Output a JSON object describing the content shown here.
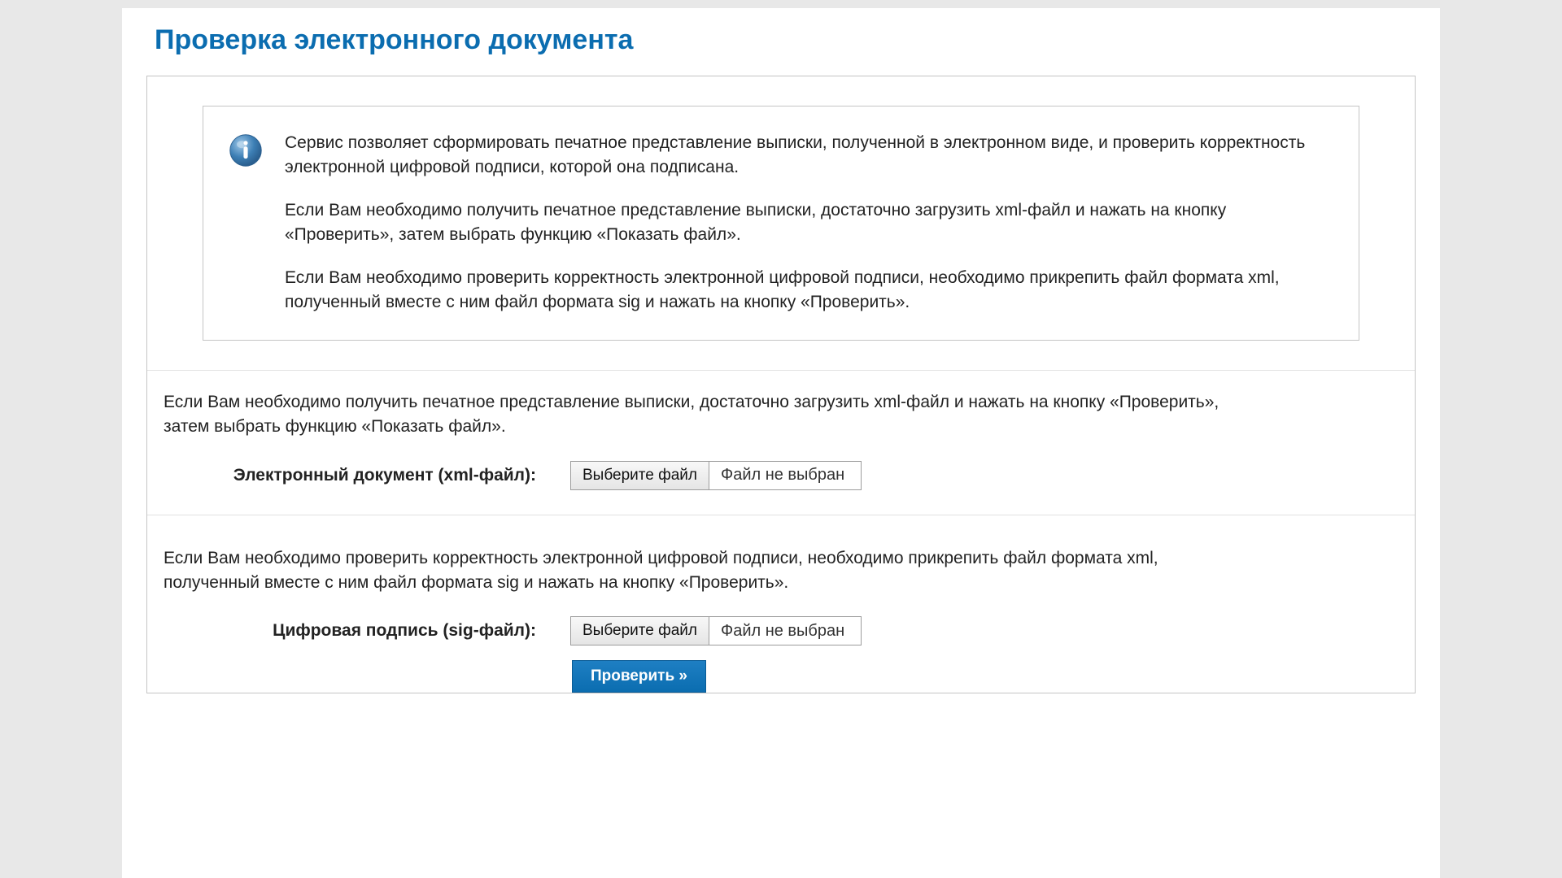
{
  "header": {
    "title": "Проверка электронного документа"
  },
  "info": {
    "p1": "Сервис позволяет сформировать печатное представление выписки, полученной в электронном виде, и проверить корректность электронной цифровой подписи, которой она подписана.",
    "p2": "Если Вам необходимо получить печатное представление выписки, достаточно загрузить xml-файл и нажать на кнопку «Проверить», затем выбрать функцию «Показать файл».",
    "p3": "Если Вам необходимо проверить корректность электронной цифровой подписи, необходимо прикрепить файл формата xml, полученный вместе с ним файл формата sig и нажать на кнопку «Проверить»."
  },
  "section_xml": {
    "text": "Если Вам необходимо получить печатное представление выписки, достаточно загрузить xml-файл и нажать на кнопку «Проверить», затем выбрать функцию «Показать файл».",
    "label": "Электронный документ (xml-файл):",
    "choose_label": "Выберите файл",
    "status": "Файл не выбран"
  },
  "section_sig": {
    "text": "Если Вам необходимо проверить корректность электронной цифровой подписи, необходимо прикрепить файл формата xml, полученный вместе с ним файл формата sig и нажать на кнопку «Проверить».",
    "label": "Цифровая подпись (sig-файл):",
    "choose_label": "Выберите файл",
    "status": "Файл не выбран"
  },
  "submit": {
    "label": "Проверить »"
  }
}
